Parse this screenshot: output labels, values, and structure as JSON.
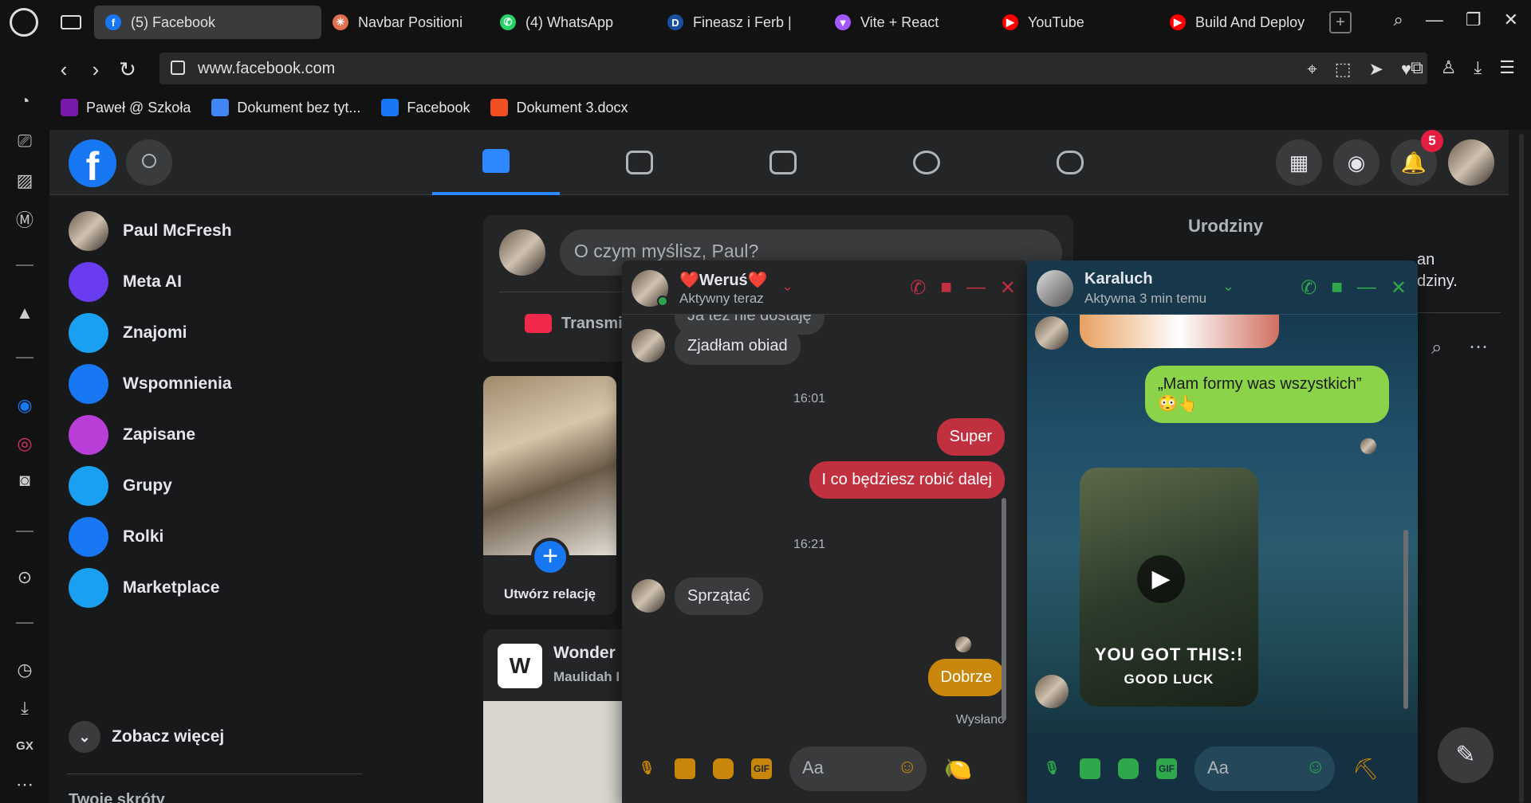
{
  "browser": {
    "tabs": [
      {
        "label": "(5) Facebook",
        "icon": "facebook-icon",
        "color": "#1877f2",
        "glyph": "f",
        "active": true
      },
      {
        "label": "Navbar Positioni",
        "icon": "sparkle-icon",
        "color": "#e07050",
        "glyph": "✳",
        "active": false
      },
      {
        "label": "(4) WhatsApp",
        "icon": "whatsapp-icon",
        "color": "#25d366",
        "glyph": "✆",
        "active": false
      },
      {
        "label": "Fineasz i Ferb |",
        "icon": "disney-icon",
        "color": "#1a4fa0",
        "glyph": "D",
        "active": false
      },
      {
        "label": "Vite + React",
        "icon": "vite-icon",
        "color": "#a259ff",
        "glyph": "▼",
        "active": false
      },
      {
        "label": "YouTube",
        "icon": "youtube-icon",
        "color": "#ff0000",
        "glyph": "▶",
        "active": false
      },
      {
        "label": "Build And Deploy",
        "icon": "youtube-icon",
        "color": "#ff0000",
        "glyph": "▶",
        "active": false
      }
    ],
    "new_tab": "+",
    "url": "www.facebook.com",
    "bookmarks": [
      {
        "label": "Paweł @ Szkoła",
        "icon": "onenote-icon",
        "color": "#7719aa"
      },
      {
        "label": "Dokument bez tyt...",
        "icon": "google-docs-icon",
        "color": "#4285f4"
      },
      {
        "label": "Facebook",
        "icon": "facebook-icon",
        "color": "#1877f2"
      },
      {
        "label": "Dokument 3.docx",
        "icon": "microsoft-icon",
        "color": "#f25022"
      }
    ],
    "sidebar_bottom_label": "GX"
  },
  "facebook": {
    "logo": "f",
    "notification_count": "5",
    "left_nav": [
      {
        "label": "Paul McFresh",
        "icon": "profile-avatar",
        "color": "#8a7866"
      },
      {
        "label": "Meta AI",
        "icon": "meta-ai-icon",
        "color": "#6a3cf0"
      },
      {
        "label": "Znajomi",
        "icon": "friends-icon",
        "color": "#1aa0f0"
      },
      {
        "label": "Wspomnienia",
        "icon": "memories-icon",
        "color": "#1877f2"
      },
      {
        "label": "Zapisane",
        "icon": "saved-icon",
        "color": "#b93ed8"
      },
      {
        "label": "Grupy",
        "icon": "groups-icon",
        "color": "#1aa0f0"
      },
      {
        "label": "Rolki",
        "icon": "reels-icon",
        "color": "#1877f2"
      },
      {
        "label": "Marketplace",
        "icon": "marketplace-icon",
        "color": "#1aa0f0"
      }
    ],
    "see_more": "Zobacz więcej",
    "shortcuts_header": "Twoje skróty",
    "composer_placeholder": "O czym myślisz, Paul?",
    "live_label": "Transmi",
    "create_story": "Utwórz relację",
    "post_page_name": "Wonder",
    "post_author": "Maulidah I",
    "birthdays_title": "Urodziny",
    "birthdays_text_1": "an",
    "birthdays_text_2": "dziny."
  },
  "chat_werus": {
    "name": "❤️Weruś❤️",
    "status": "Aktywny teraz",
    "partial_msg": "Ja też nie dostaję",
    "messages": [
      {
        "dir": "in",
        "text": "Zjadłam obiad"
      },
      {
        "dir": "time",
        "text": "16:01"
      },
      {
        "dir": "out",
        "text": "Super"
      },
      {
        "dir": "out",
        "text": "I co będziesz robić dalej"
      },
      {
        "dir": "time",
        "text": "16:21"
      },
      {
        "dir": "in",
        "text": "Sprzątać"
      },
      {
        "dir": "out",
        "text": "Dobrze"
      }
    ],
    "sent_label": "Wysłano",
    "input_placeholder": "Aa",
    "out_color_1": "#c0303f",
    "out_color_last": "#c8860a",
    "emoji_like": "🍋"
  },
  "chat_karaluch": {
    "name": "Karaluch",
    "status": "Aktywna 3 min temu",
    "message_out": "„Mam formy was wszystkich”",
    "message_emoji": "😳👆",
    "gif_title": "YOU GOT THIS:!",
    "gif_subtitle": "GOOD LUCK",
    "input_placeholder": "Aa",
    "accent": "#2ea84a",
    "bubble_color": "#8bd449"
  }
}
